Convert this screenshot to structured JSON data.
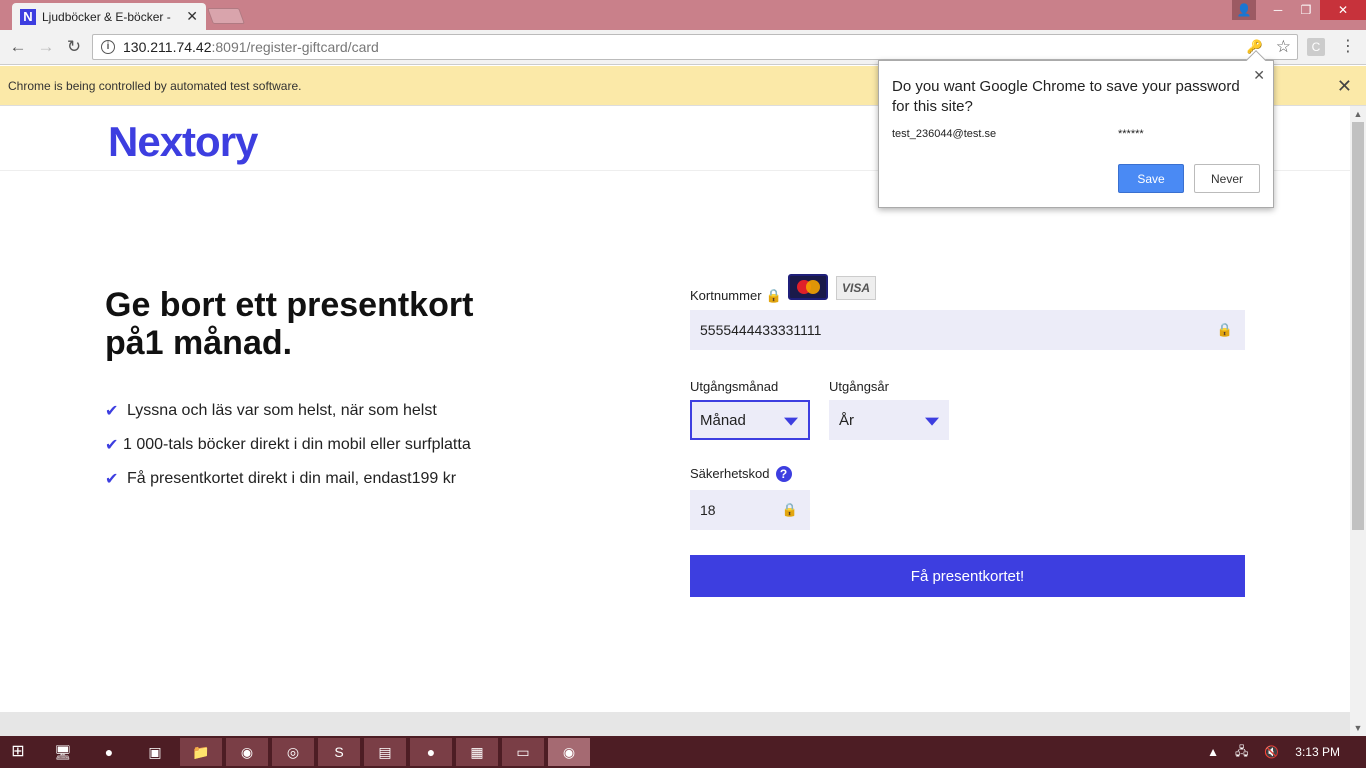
{
  "browser": {
    "tab_title": "Ljudböcker & E-böcker -",
    "tab_favicon": "N",
    "url_host": "130.211.74.42",
    "url_rest": ":8091/register-giftcard/card",
    "infobar_text": "Chrome is being controlled by automated test software.",
    "ext_label": "C"
  },
  "password_bubble": {
    "question": "Do you want Google Chrome to save your password for this site?",
    "username": "test_236044@test.se",
    "password_mask": "******",
    "save_label": "Save",
    "never_label": "Never"
  },
  "site": {
    "logo": "Nextory",
    "headline": "Ge bort ett presentkort på1 månad.",
    "features": [
      "Lyssna och läs var som helst, när som helst",
      "1 000-tals böcker direkt i din mobil eller surfplatta",
      "Få presentkortet direkt i din mail, endast199 kr"
    ],
    "form": {
      "card_number_label": "Kortnummer",
      "card_number_value": "5555444433331111",
      "visa_label": "VISA",
      "month_label": "Utgångsmånad",
      "month_value": "Månad",
      "year_label": "Utgångsår",
      "year_value": "År",
      "cvc_label": "Säkerhetskod",
      "cvc_value": "18",
      "submit_label": "Få presentkortet!"
    }
  },
  "taskbar": {
    "clock": "3:13 PM"
  },
  "colors": {
    "brand": "#3d3ee0",
    "titlebar": "#c9808a",
    "taskbar": "#4d1d24"
  }
}
